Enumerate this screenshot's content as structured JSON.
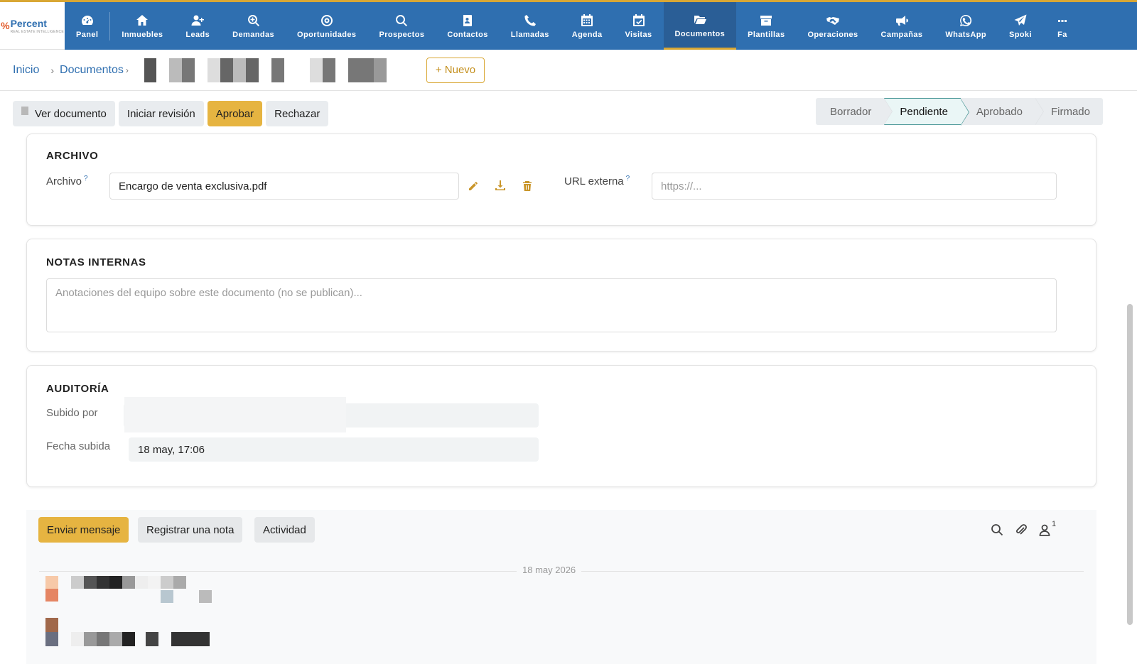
{
  "brand": {
    "name": "Percent",
    "tagline": "REAL ESTATE INTELLIGENCE"
  },
  "nav": {
    "items": [
      {
        "label": "Panel",
        "icon": "dashboard-icon"
      },
      {
        "label": "Inmuebles",
        "icon": "home-icon"
      },
      {
        "label": "Leads",
        "icon": "user-plus-icon"
      },
      {
        "label": "Demandas",
        "icon": "search-plus-icon"
      },
      {
        "label": "Oportunidades",
        "icon": "target-icon"
      },
      {
        "label": "Prospectos",
        "icon": "search-icon"
      },
      {
        "label": "Contactos",
        "icon": "contact-book-icon"
      },
      {
        "label": "Llamadas",
        "icon": "phone-icon"
      },
      {
        "label": "Agenda",
        "icon": "calendar-icon"
      },
      {
        "label": "Visitas",
        "icon": "calendar-check-icon"
      },
      {
        "label": "Documentos",
        "icon": "folder-open-icon",
        "active": true
      },
      {
        "label": "Plantillas",
        "icon": "archive-icon"
      },
      {
        "label": "Operaciones",
        "icon": "handshake-icon"
      },
      {
        "label": "Campañas",
        "icon": "megaphone-icon"
      },
      {
        "label": "WhatsApp",
        "icon": "whatsapp-icon"
      },
      {
        "label": "Spoki",
        "icon": "paper-plane-icon"
      },
      {
        "label": "Fa",
        "icon": "more-icon"
      }
    ]
  },
  "breadcrumb": {
    "home": "Inicio",
    "section": "Documentos",
    "new_label": "+ Nuevo"
  },
  "actions": {
    "view_doc": "Ver documento",
    "start_review": "Iniciar revisión",
    "approve": "Aprobar",
    "reject": "Rechazar"
  },
  "stages": [
    {
      "label": "Borrador",
      "active": false
    },
    {
      "label": "Pendiente",
      "active": true
    },
    {
      "label": "Aprobado",
      "active": false
    },
    {
      "label": "Firmado",
      "active": false
    }
  ],
  "archivo": {
    "title": "ARCHIVO",
    "file_label": "Archivo",
    "file_value": "Encargo de venta exclusiva.pdf",
    "url_label": "URL externa",
    "url_placeholder": "https://...",
    "help": "?"
  },
  "notas": {
    "title": "NOTAS INTERNAS",
    "placeholder": "Anotaciones del equipo sobre este documento (no se publican)..."
  },
  "auditoria": {
    "title": "AUDITORÍA",
    "uploaded_by_label": "Subido por",
    "uploaded_by_value": "",
    "date_label": "Fecha subida",
    "date_value": "18 may, 17:06"
  },
  "chatter": {
    "send_message": "Enviar mensaje",
    "log_note": "Registrar una nota",
    "activity": "Actividad",
    "followers_count": "1",
    "date_separator": "18 may 2026"
  },
  "colors": {
    "nav_bg": "#2f6fb0",
    "accent": "#e6b441",
    "stage_active_border": "#4f9a9a"
  }
}
